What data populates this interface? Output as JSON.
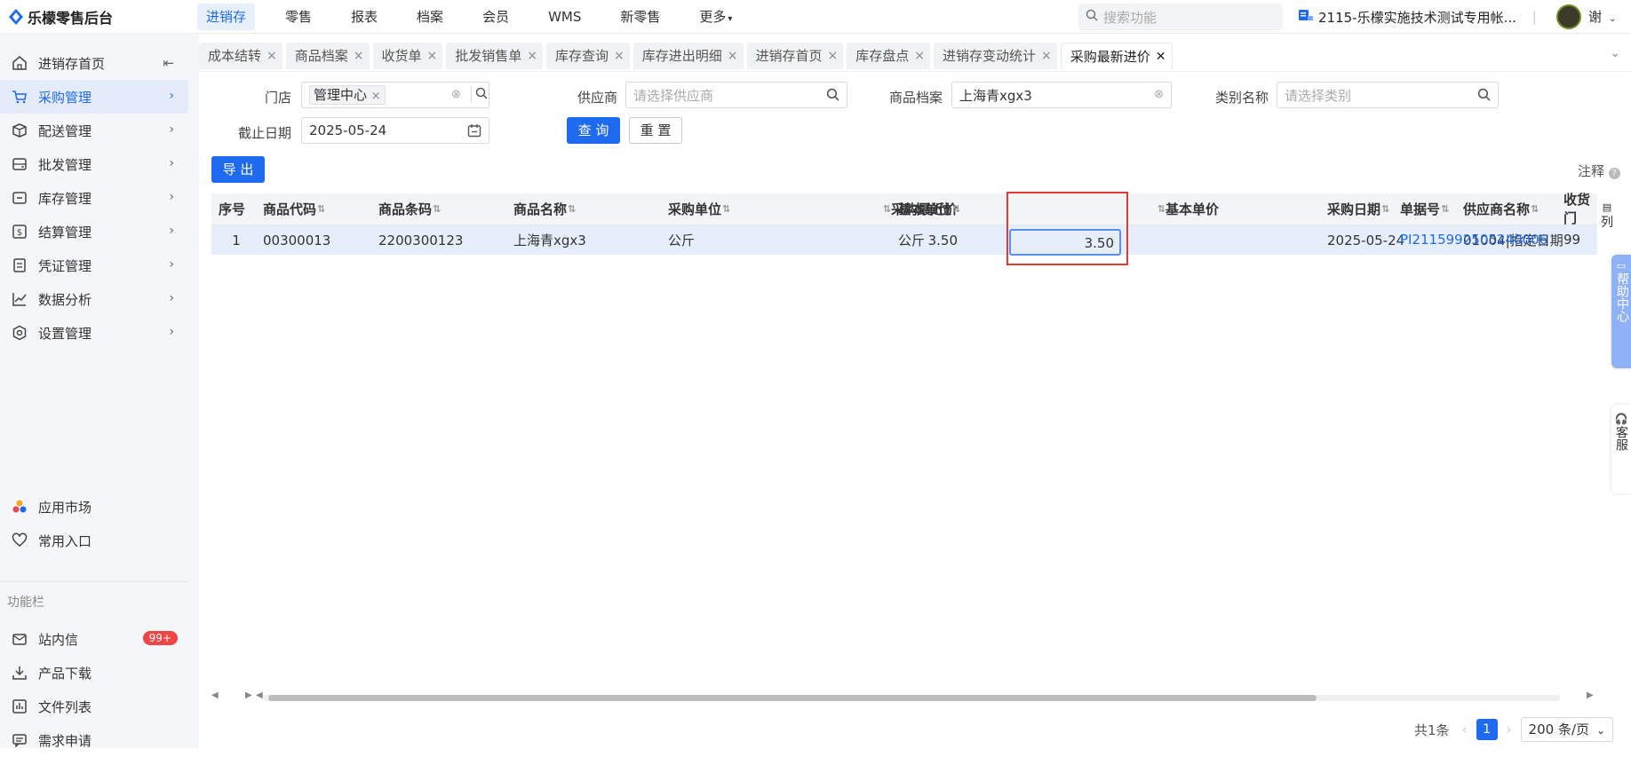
{
  "app": {
    "title": "乐檬零售后台"
  },
  "topnav": [
    {
      "label": "进销存",
      "active": true
    },
    {
      "label": "零售"
    },
    {
      "label": "报表"
    },
    {
      "label": "档案"
    },
    {
      "label": "会员"
    },
    {
      "label": "WMS"
    },
    {
      "label": "新零售"
    },
    {
      "label": "更多"
    }
  ],
  "search": {
    "placeholder": "搜索功能"
  },
  "account": {
    "name": "2115-乐檬实施技术测试专用帐...",
    "user": "谢"
  },
  "sidebar": {
    "items": [
      {
        "label": "进销存首页",
        "icon": "home-icon"
      },
      {
        "label": "采购管理",
        "icon": "cart-icon",
        "active": true
      },
      {
        "label": "配送管理",
        "icon": "package-icon"
      },
      {
        "label": "批发管理",
        "icon": "wallet-icon"
      },
      {
        "label": "库存管理",
        "icon": "inventory-icon"
      },
      {
        "label": "结算管理",
        "icon": "settlement-icon"
      },
      {
        "label": "凭证管理",
        "icon": "document-icon"
      },
      {
        "label": "数据分析",
        "icon": "chart-line-icon"
      },
      {
        "label": "设置管理",
        "icon": "settings-icon"
      }
    ],
    "app_market": "应用市场",
    "common_entry": "常用入口",
    "section": "功能栏",
    "func_items": [
      {
        "label": "站内信",
        "badge": "99+"
      },
      {
        "label": "产品下载"
      },
      {
        "label": "文件列表"
      },
      {
        "label": "需求申请"
      }
    ]
  },
  "tabs": [
    {
      "label": "成本结转"
    },
    {
      "label": "商品档案"
    },
    {
      "label": "收货单"
    },
    {
      "label": "批发销售单"
    },
    {
      "label": "库存查询"
    },
    {
      "label": "库存进出明细"
    },
    {
      "label": "进销存首页"
    },
    {
      "label": "库存盘点"
    },
    {
      "label": "进销存变动统计"
    },
    {
      "label": "采购最新进价",
      "active": true
    }
  ],
  "filters": {
    "store_label": "门店",
    "store_tag": "管理中心",
    "supplier_label": "供应商",
    "supplier_placeholder": "请选择供应商",
    "product_label": "商品档案",
    "product_value": "上海青xgx3",
    "category_label": "类别名称",
    "category_placeholder": "请选择类别",
    "date_label": "截止日期",
    "date_value": "2025-05-24",
    "query_btn": "查 询",
    "reset_btn": "重 置"
  },
  "toolbar": {
    "export_btn": "导 出",
    "notes": "注释"
  },
  "table": {
    "columns": [
      "序号",
      "商品代码",
      "商品条码",
      "商品名称",
      "采购单位",
      "采购最近价",
      "基本单位",
      "基本单价",
      "采购日期",
      "供应商名称",
      "单据号",
      "收货门"
    ],
    "rows": [
      [
        "1",
        "00300013",
        "2200300123",
        "上海青xgx3",
        "公斤",
        "3.50",
        "公斤",
        "3.50",
        "2025-05-24",
        "01004|指定日期",
        "PI2115992505240006",
        "99"
      ]
    ],
    "column_toggle": "列"
  },
  "pagination": {
    "total": "共1条",
    "current": "1",
    "page_size": "200 条/页"
  },
  "floating": {
    "help": "帮助中心",
    "service": "客服"
  },
  "colors": {
    "accent": "#1f6bf0",
    "highlight": "#e53935",
    "badge": "#f04545"
  }
}
